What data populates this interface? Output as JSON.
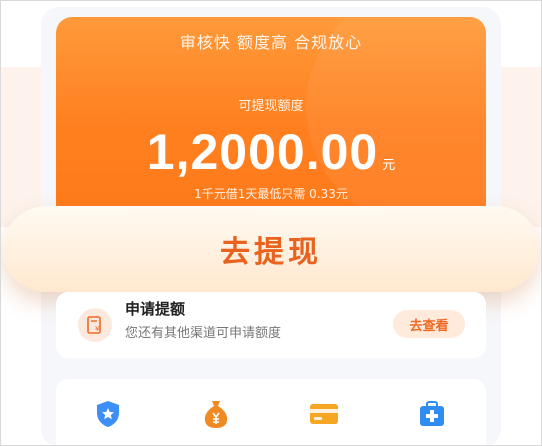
{
  "hero": {
    "slogan": "审核快 额度高 合规放心",
    "amount_label": "可提现额度",
    "amount": "1,2000.00",
    "unit": "元",
    "rate_text": "1千元借1天最低只需  0.33元"
  },
  "actions": {
    "withdraw_label": "去提现"
  },
  "apply": {
    "title": "申请提额",
    "description": "您还有其他渠道可申请额度",
    "view_label": "去查看",
    "icon_mark": "¥"
  },
  "colors": {
    "brand_orange": "#ff7f1f",
    "button_text": "#e9631e",
    "shield_blue": "#3e8ef7",
    "coin_orange": "#f08a24",
    "card_orange": "#f5a623",
    "medical_blue": "#2f8cf0"
  },
  "bottom_nav": {
    "icons": [
      "shield-star-icon",
      "money-bag-icon",
      "bank-card-icon",
      "medical-kit-icon"
    ]
  }
}
